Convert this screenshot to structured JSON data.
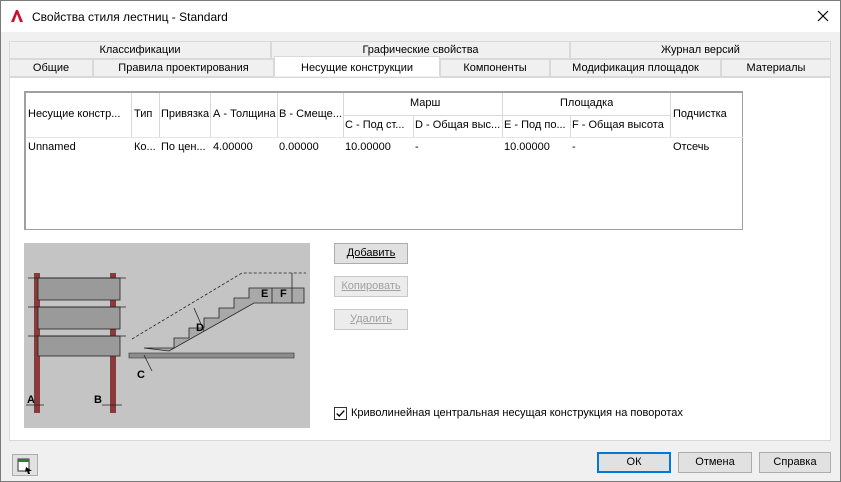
{
  "window": {
    "title": "Свойства стиля лестниц - Standard"
  },
  "tabs": {
    "row1": [
      "Классификации",
      "Графические свойства",
      "Журнал версий"
    ],
    "row2": [
      "Общие",
      "Правила проектирования",
      "Несущие конструкции",
      "Компоненты",
      "Модификация площадок",
      "Материалы"
    ],
    "active": "Несущие конструкции"
  },
  "grid": {
    "group_headers": {
      "march": "Марш",
      "landing": "Площадка"
    },
    "columns": [
      "Несущие констр...",
      "Тип",
      "Привязка",
      "А - Толщина",
      "В - Смеще...",
      "С - Под ст...",
      "D - Общая выс...",
      "Е - Под по...",
      "F - Общая высота",
      "Подчистка"
    ],
    "rows": [
      [
        "Unnamed",
        "Ко...",
        "По цен...",
        "4.00000",
        "0.00000",
        "10.00000",
        "-",
        "10.00000",
        "-",
        "Отсечь"
      ]
    ]
  },
  "illustration": {
    "labels": [
      "A",
      "B",
      "C",
      "D",
      "E",
      "F"
    ]
  },
  "buttons": {
    "add": "Добавить",
    "copy": "Копировать",
    "delete": "Удалить",
    "ok": "ОК",
    "cancel": "Отмена",
    "help": "Справка"
  },
  "checkbox": {
    "label": "Криволинейная центральная несущая конструкция на поворотах",
    "checked": true
  },
  "colors": {
    "accent": "#0078d7",
    "app_icon": "#c8102e"
  }
}
